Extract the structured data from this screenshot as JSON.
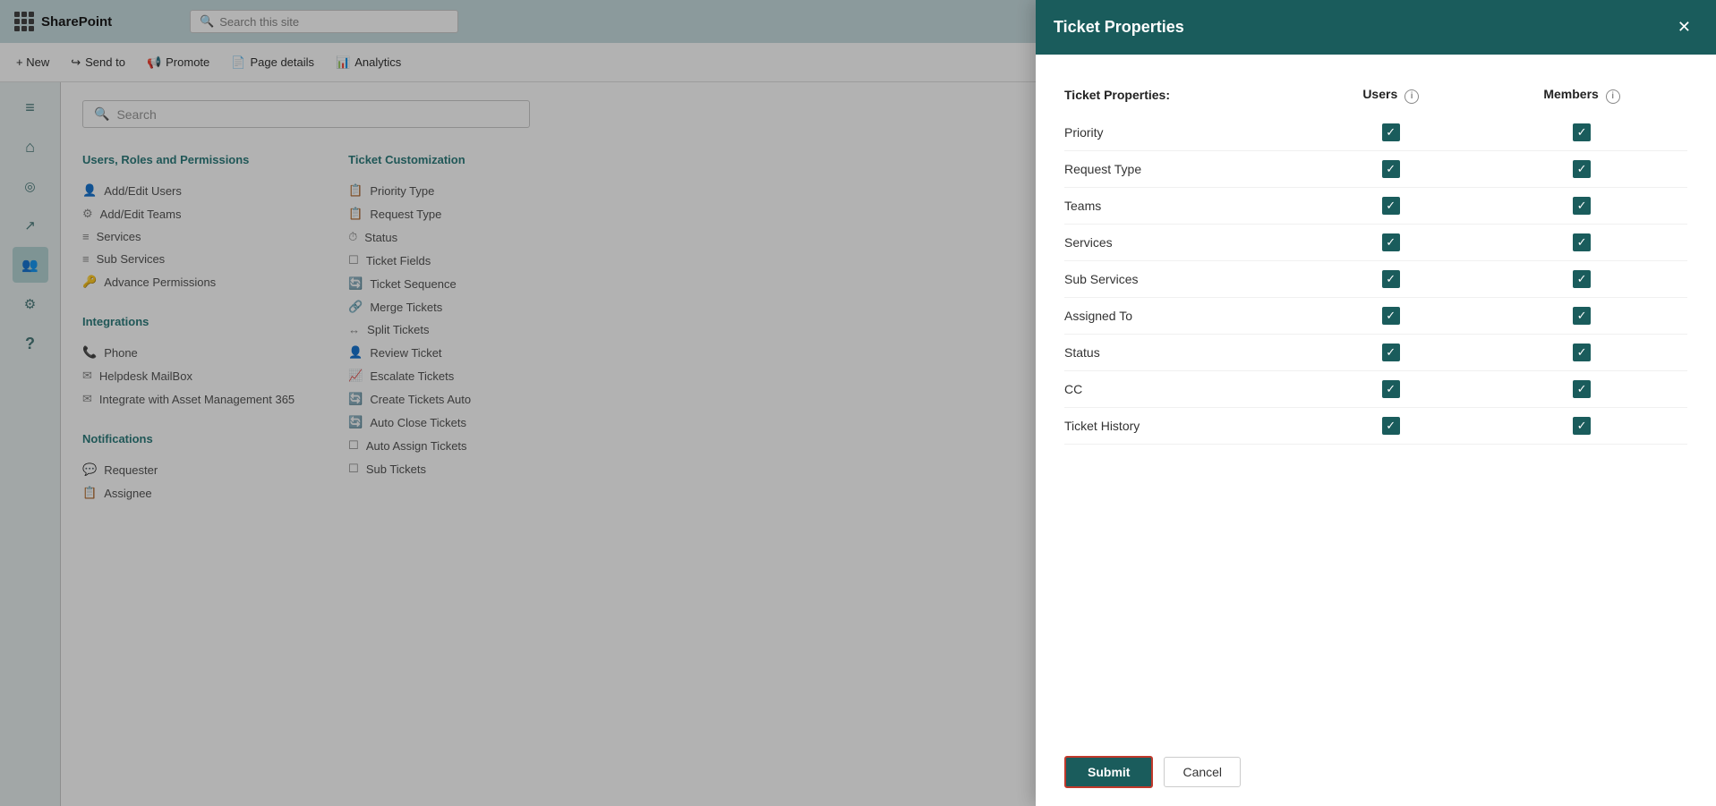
{
  "app": {
    "logo": "SharePoint",
    "search_placeholder": "Search this site"
  },
  "command_bar": {
    "new_label": "+ New",
    "send_to_label": "Send to",
    "promote_label": "Promote",
    "page_details_label": "Page details",
    "analytics_label": "Analytics"
  },
  "sidebar": {
    "icons": [
      {
        "name": "menu-icon",
        "symbol": "≡"
      },
      {
        "name": "home-icon",
        "symbol": "⌂"
      },
      {
        "name": "search-nav-icon",
        "symbol": "○"
      },
      {
        "name": "chart-icon",
        "symbol": "↗"
      },
      {
        "name": "people-icon",
        "symbol": "⚙"
      },
      {
        "name": "settings-icon",
        "symbol": "⚙"
      },
      {
        "name": "help-icon",
        "symbol": "?"
      }
    ]
  },
  "content": {
    "search_placeholder": "Search",
    "sections": [
      {
        "title": "Users, Roles and Permissions",
        "items": [
          {
            "icon": "👤",
            "label": "Add/Edit Users"
          },
          {
            "icon": "⚙",
            "label": "Add/Edit Teams"
          },
          {
            "icon": "≡",
            "label": "Services"
          },
          {
            "icon": "≡",
            "label": "Sub Services"
          },
          {
            "icon": "🔑",
            "label": "Advance Permissions"
          }
        ]
      },
      {
        "title": "Integrations",
        "items": [
          {
            "icon": "📞",
            "label": "Phone"
          },
          {
            "icon": "✉",
            "label": "Helpdesk MailBox"
          },
          {
            "icon": "✉",
            "label": "Integrate with Asset Management 365"
          }
        ]
      },
      {
        "title": "Notifications",
        "items": [
          {
            "icon": "💬",
            "label": "Requester"
          },
          {
            "icon": "📋",
            "label": "Assignee"
          }
        ]
      },
      {
        "title": "Ticket Customization",
        "items": [
          {
            "icon": "📋",
            "label": "Priority Type"
          },
          {
            "icon": "📋",
            "label": "Request Type"
          },
          {
            "icon": "⏱",
            "label": "Status"
          },
          {
            "icon": "☐",
            "label": "Ticket Fields"
          },
          {
            "icon": "🔄",
            "label": "Ticket Sequence"
          },
          {
            "icon": "🔗",
            "label": "Merge Tickets"
          },
          {
            "icon": "↔",
            "label": "Split Tickets"
          },
          {
            "icon": "👤",
            "label": "Review Ticket"
          },
          {
            "icon": "📈",
            "label": "Escalate Tickets"
          },
          {
            "icon": "🔄",
            "label": "Create Tickets Auto"
          },
          {
            "icon": "🔄",
            "label": "Auto Close Tickets"
          },
          {
            "icon": "☐",
            "label": "Auto Assign Tickets"
          },
          {
            "icon": "☐",
            "label": "Sub Tickets"
          }
        ]
      }
    ]
  },
  "modal": {
    "title": "Ticket Properties",
    "close_label": "✕",
    "section_label": "Ticket Properties:",
    "col_users": "Users",
    "col_members": "Members",
    "rows": [
      {
        "property": "Priority",
        "users": true,
        "members": true
      },
      {
        "property": "Request Type",
        "users": true,
        "members": true
      },
      {
        "property": "Teams",
        "users": true,
        "members": true
      },
      {
        "property": "Services",
        "users": true,
        "members": true
      },
      {
        "property": "Sub Services",
        "users": true,
        "members": true
      },
      {
        "property": "Assigned To",
        "users": true,
        "members": true
      },
      {
        "property": "Status",
        "users": true,
        "members": true
      },
      {
        "property": "CC",
        "users": true,
        "members": true
      },
      {
        "property": "Ticket History",
        "users": true,
        "members": true
      }
    ],
    "submit_label": "Submit",
    "cancel_label": "Cancel"
  }
}
